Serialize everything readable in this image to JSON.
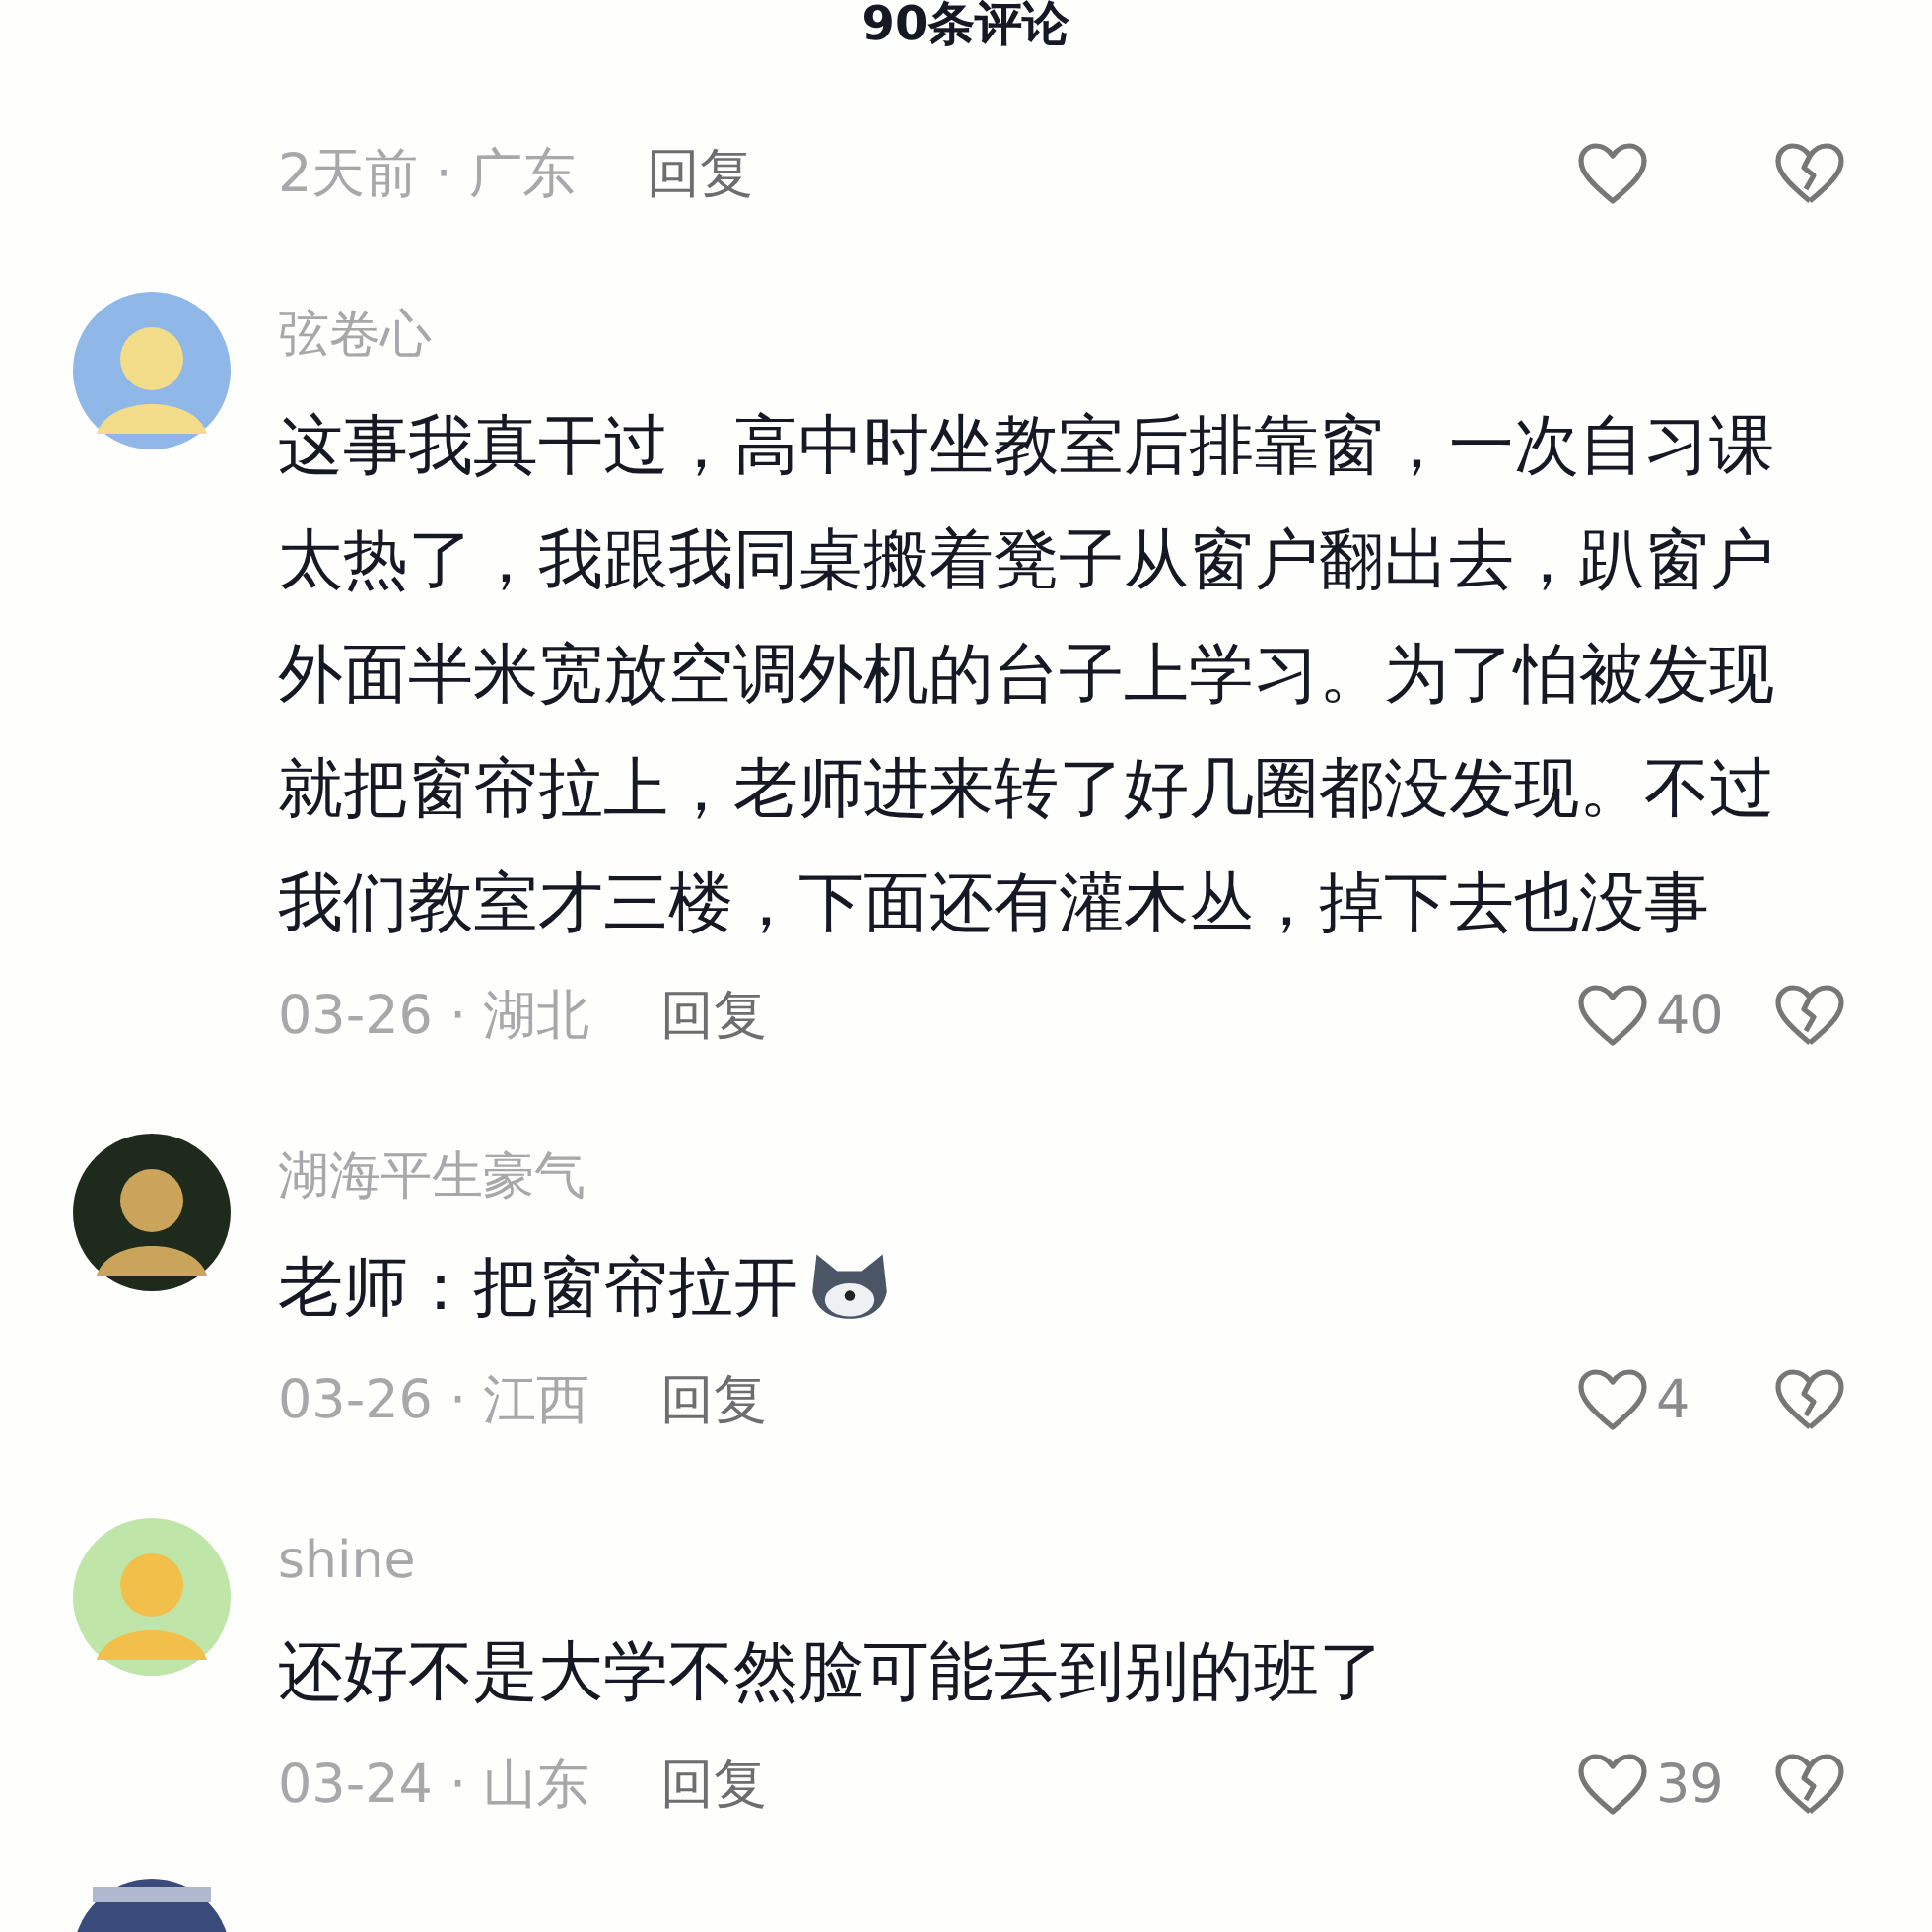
{
  "title": "90条评论",
  "top_meta": {
    "time_location": "2天前 · 广东",
    "reply": "回复"
  },
  "comments": [
    {
      "name": "弦卷心",
      "text": "这事我真干过，高中时坐教室后排靠窗，一次自习课太热了，我跟我同桌搬着凳子从窗户翻出去，趴窗户外面半米宽放空调外机的台子上学习。为了怕被发现就把窗帘拉上，老师进来转了好几圈都没发现。不过我们教室才三楼，下面还有灌木丛，掉下去也没事",
      "has_emoji": false,
      "time_location": "03-26 · 湖北",
      "reply": "回复",
      "likes": "40"
    },
    {
      "name": "湖海平生豪气",
      "text": "老师：把窗帘拉开",
      "has_emoji": true,
      "time_location": "03-26 · 江西",
      "reply": "回复",
      "likes": "4"
    },
    {
      "name": "shine",
      "text": "还好不是大学不然脸可能丢到别的班了",
      "has_emoji": false,
      "time_location": "03-24 · 山东",
      "reply": "回复",
      "likes": "39"
    }
  ]
}
